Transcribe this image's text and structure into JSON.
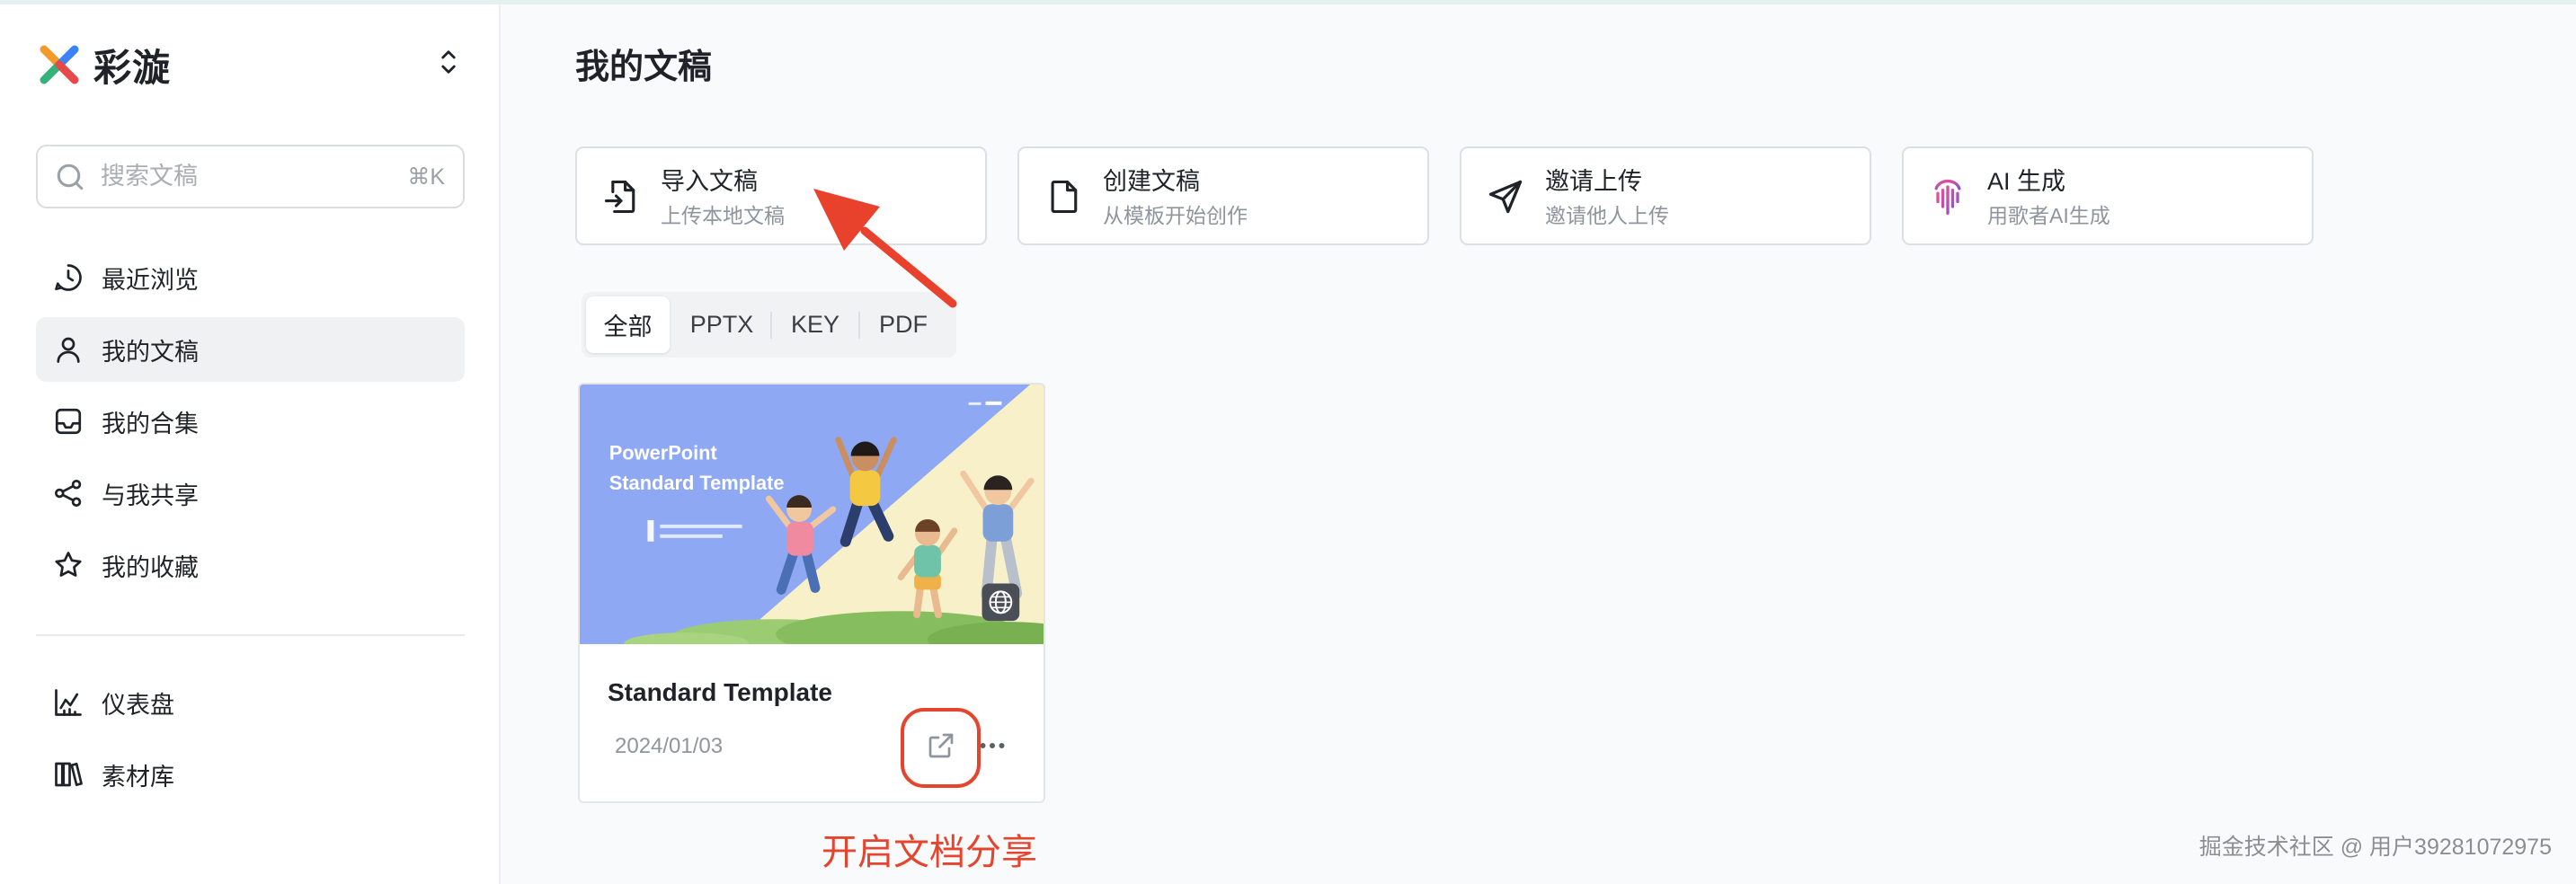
{
  "app": {
    "name": "彩漩"
  },
  "sidebar": {
    "search": {
      "placeholder": "搜索文稿",
      "shortcut": "⌘K"
    },
    "nav": [
      {
        "label": "最近浏览",
        "icon": "history-clock-icon",
        "active": false
      },
      {
        "label": "我的文稿",
        "icon": "user-icon",
        "active": true
      },
      {
        "label": "我的合集",
        "icon": "inbox-icon",
        "active": false
      },
      {
        "label": "与我共享",
        "icon": "share-nodes-icon",
        "active": false
      },
      {
        "label": "我的收藏",
        "icon": "star-icon",
        "active": false
      }
    ],
    "tools": [
      {
        "label": "仪表盘",
        "icon": "chart-icon"
      },
      {
        "label": "素材库",
        "icon": "library-icon"
      }
    ]
  },
  "main": {
    "title": "我的文稿",
    "actions": [
      {
        "title": "导入文稿",
        "subtitle": "上传本地文稿",
        "icon": "import-file-icon"
      },
      {
        "title": "创建文稿",
        "subtitle": "从模板开始创作",
        "icon": "file-icon"
      },
      {
        "title": "邀请上传",
        "subtitle": "邀请他人上传",
        "icon": "paper-plane-icon"
      },
      {
        "title": "AI 生成",
        "subtitle": "用歌者AI生成",
        "icon": "ai-wave-icon"
      }
    ],
    "filters": [
      {
        "label": "全部",
        "active": true
      },
      {
        "label": "PPTX",
        "active": false
      },
      {
        "label": "KEY",
        "active": false
      },
      {
        "label": "PDF",
        "active": false
      }
    ],
    "documents": [
      {
        "title": "Standard Template",
        "date": "2024/01/03",
        "thumbnail": {
          "line_1": "PowerPoint",
          "line_2": "Standard Template",
          "badge_icon": "globe-icon"
        },
        "actions": [
          {
            "icon": "external-link-icon"
          },
          {
            "icon": "more-dots-icon"
          }
        ]
      }
    ]
  },
  "annotation": {
    "callout": "开启文档分享",
    "color": "#e4452e"
  },
  "watermark": "掘金技术社区 @ 用户39281072975",
  "colors": {
    "text": "#1f2329",
    "muted": "#8f959e",
    "active_bg": "#f0f1f3",
    "border": "#dcdfe4",
    "page_bg": "#f9fafb"
  }
}
